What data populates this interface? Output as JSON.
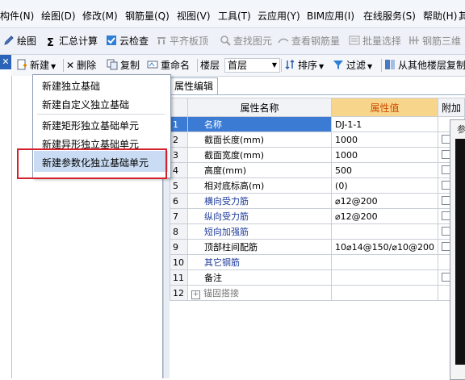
{
  "menubar": {
    "items": [
      "构件(N)",
      "绘图(D)",
      "修改(M)",
      "钢筋量(Q)",
      "视图(V)",
      "工具(T)",
      "云应用(Y)",
      "BIM应用(I)",
      "在线服务(S)",
      "帮助(H)",
      "其"
    ]
  },
  "toolbar1": {
    "draw": "绘图",
    "sum": "汇总计算",
    "cloud_check": "云检查",
    "flat_top": "平齐板顶",
    "find_element": "查找图元",
    "view_rebar": "查看钢筋量",
    "batch_select": "批量选择",
    "rebar_3d": "钢筋三维"
  },
  "left_panel": {
    "close_glyph": "✕"
  },
  "toolbar2": {
    "new": "新建",
    "delete": "删除",
    "copy": "复制",
    "rename": "重命名",
    "floor_label": "楼层",
    "floor_value": "首层",
    "sort": "排序",
    "filter": "过滤",
    "copy_from_other": "从其他楼层复制"
  },
  "dropdown": {
    "items": [
      "新建独立基础",
      "新建自定义独立基础",
      "新建矩形独立基础单元",
      "新建异形独立基础单元",
      "新建参数化独立基础单元"
    ],
    "highlighted_index": 4
  },
  "property_editor": {
    "tab_label": "属性编辑",
    "columns": [
      "属性名称",
      "属性值",
      "附加"
    ],
    "rows": [
      {
        "num": "1",
        "name": "名称",
        "value": "DJ-1-1",
        "style": "selected",
        "checkbox": false
      },
      {
        "num": "2",
        "name": "截面长度(mm)",
        "value": "1000",
        "style": "normal",
        "checkbox": true
      },
      {
        "num": "3",
        "name": "截面宽度(mm)",
        "value": "1000",
        "style": "normal",
        "checkbox": true
      },
      {
        "num": "4",
        "name": "高度(mm)",
        "value": "500",
        "style": "normal",
        "checkbox": true
      },
      {
        "num": "5",
        "name": "相对底标高(m)",
        "value": "(0)",
        "style": "normal",
        "checkbox": true
      },
      {
        "num": "6",
        "name": "横向受力筋",
        "value": "⌀12@200",
        "style": "blue",
        "checkbox": true
      },
      {
        "num": "7",
        "name": "纵向受力筋",
        "value": "⌀12@200",
        "style": "blue",
        "checkbox": true
      },
      {
        "num": "8",
        "name": "短向加强筋",
        "value": "",
        "style": "blue",
        "checkbox": true
      },
      {
        "num": "9",
        "name": "顶部柱间配筋",
        "value": "10⌀14@150/⌀10@200",
        "style": "normal",
        "checkbox": true
      },
      {
        "num": "10",
        "name": "其它钢筋",
        "value": "",
        "style": "blue",
        "checkbox": false
      },
      {
        "num": "11",
        "name": "备注",
        "value": "",
        "style": "normal",
        "checkbox": true
      },
      {
        "num": "12",
        "name": "锚固搭接",
        "value": "",
        "style": "gray",
        "checkbox": false,
        "expandable": true,
        "expand_glyph": "+"
      }
    ]
  },
  "mini_panel": {
    "title": "参"
  },
  "colors": {
    "selection_blue": "#3b7bd4",
    "highlight_red": "#d5212b",
    "value_header_bg": "#f7d58b",
    "value_header_text": "#d04a00",
    "link_blue": "#1f3c9a"
  }
}
